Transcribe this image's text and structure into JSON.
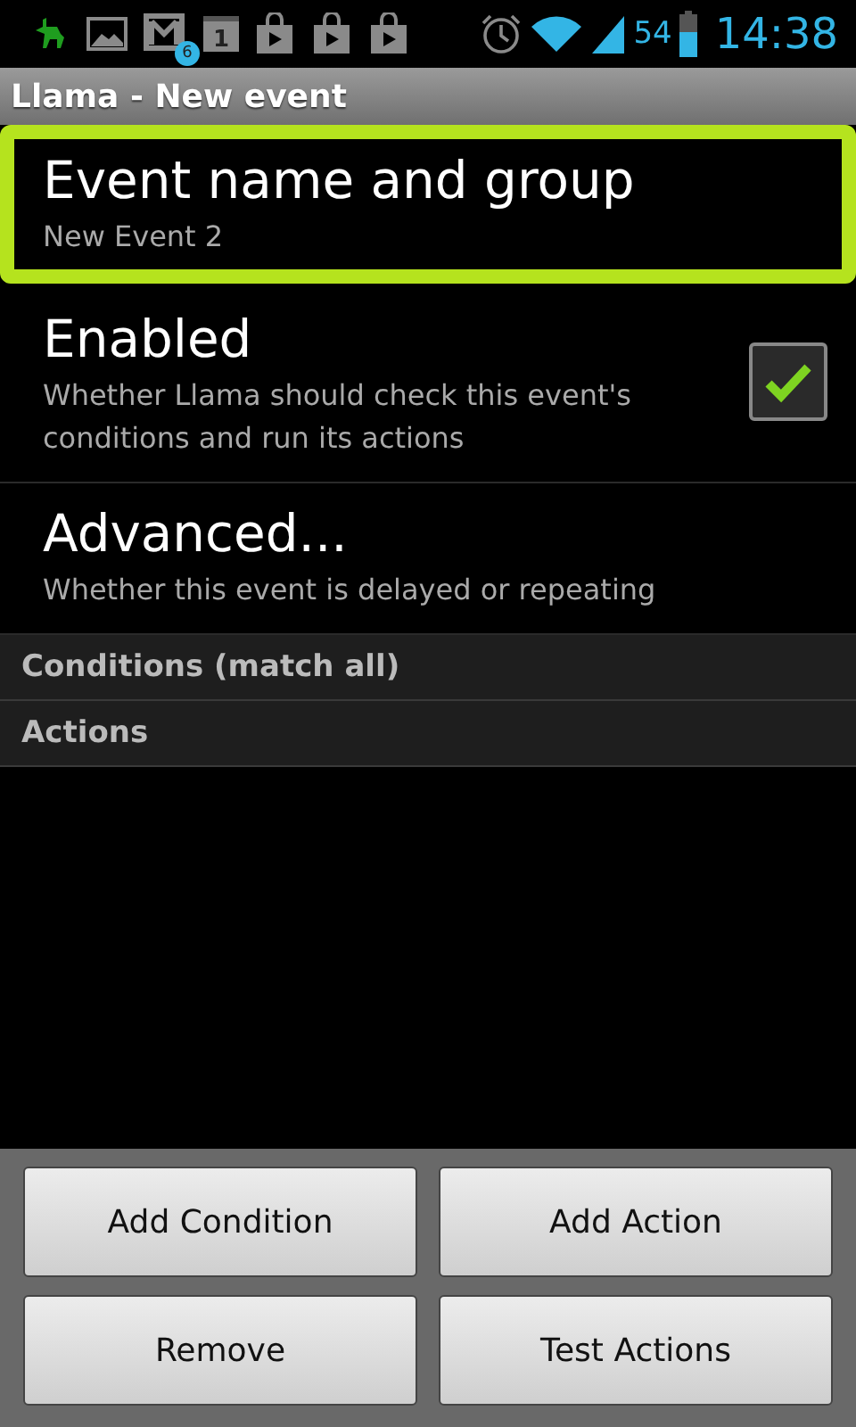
{
  "status_bar": {
    "mail_count": "6",
    "calendar_day": "1",
    "battery": "54",
    "time": "14:38"
  },
  "window": {
    "title": "Llama - New event"
  },
  "preferences": [
    {
      "kind": "text",
      "title": "Event name and group",
      "summary": "New Event 2",
      "selected": true
    },
    {
      "kind": "checkbox",
      "title": "Enabled",
      "summary": "Whether Llama should check this event's conditions and run its actions",
      "selected": false,
      "checked": true
    },
    {
      "kind": "text",
      "title": "Advanced...",
      "summary": "Whether this event is delayed or repeating",
      "selected": false
    }
  ],
  "sections": [
    "Conditions (match all)",
    "Actions"
  ],
  "buttons": [
    "Add Condition",
    "Add Action",
    "Remove",
    "Test Actions"
  ]
}
